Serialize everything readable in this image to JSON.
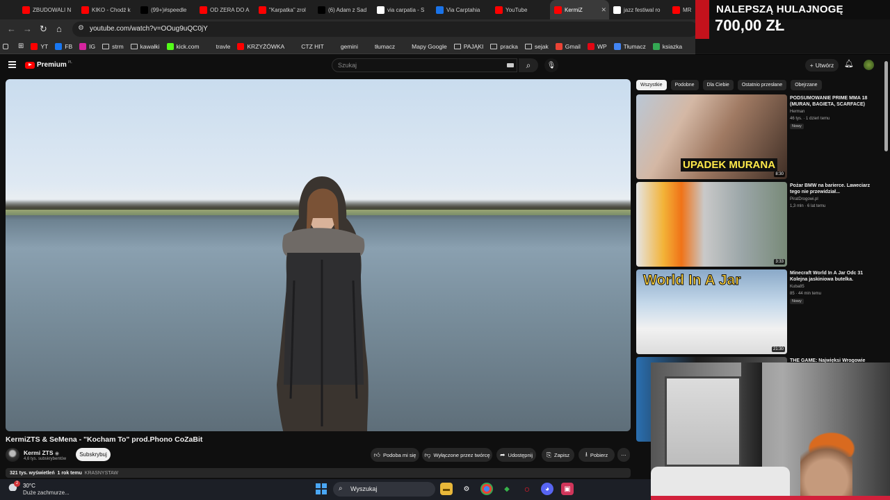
{
  "browser": {
    "tabs": [
      {
        "label": "ZBUDOWALI N",
        "icon": "youtube-icon",
        "color": "#ff0000"
      },
      {
        "label": "KIKO - Chodź k",
        "icon": "youtube-icon",
        "color": "#ff0000"
      },
      {
        "label": "(99+)#speedle",
        "icon": "tiktok-icon",
        "color": "#000000"
      },
      {
        "label": "OD ZERA DO A",
        "icon": "youtube-icon",
        "color": "#ff0000"
      },
      {
        "label": "\"Karpatka\" zrol",
        "icon": "youtube-icon",
        "color": "#ff0000"
      },
      {
        "label": "(6) Adam z Sad",
        "icon": "x-icon",
        "color": "#000000"
      },
      {
        "label": "via carpatia - S",
        "icon": "google-icon",
        "color": "#ffffff"
      },
      {
        "label": "Via Carptahia",
        "icon": "map-icon",
        "color": "#1a73e8"
      },
      {
        "label": "YouTube",
        "icon": "youtube-icon",
        "color": "#ff0000"
      },
      {
        "label": "KermiZ",
        "icon": "youtube-icon",
        "color": "#ff0000",
        "active": true
      },
      {
        "label": "jazz festiwal ro",
        "icon": "google-icon",
        "color": "#ffffff"
      },
      {
        "label": "MR",
        "icon": "youtube-icon",
        "color": "#ff0000"
      }
    ],
    "close_glyph": "✕",
    "url": "youtube.com/watch?v=OOug9uQC0jY",
    "bookmarks": [
      {
        "label": "YT",
        "icon": "youtube-icon",
        "color": "#ff0000"
      },
      {
        "label": "FB",
        "icon": "facebook-icon",
        "color": "#1877f2"
      },
      {
        "label": "IG",
        "icon": "instagram-icon",
        "color": "#d6249f"
      },
      {
        "label": "strm",
        "icon": "folder-icon",
        "color": "transparent"
      },
      {
        "label": "kawałki",
        "icon": "folder-icon",
        "color": "transparent"
      },
      {
        "label": "kick.com",
        "icon": "kick-icon",
        "color": "#53fc18"
      },
      {
        "label": "travle",
        "icon": "compass-icon",
        "color": "transparent"
      },
      {
        "label": "KRZYŻÓWKA",
        "icon": "youtube-icon",
        "color": "#ff0000"
      },
      {
        "label": "CTZ HIT",
        "icon": "gamepad-icon",
        "color": "transparent"
      },
      {
        "label": "gemini",
        "icon": "gemini-icon",
        "color": "transparent"
      },
      {
        "label": "tłumacz",
        "icon": "translate-icon",
        "color": "transparent"
      },
      {
        "label": "Mapy Google",
        "icon": "maps-pin-icon",
        "color": "transparent"
      },
      {
        "label": "PAJĄKI",
        "icon": "folder-icon",
        "color": "transparent"
      },
      {
        "label": "pracka",
        "icon": "folder-icon",
        "color": "transparent"
      },
      {
        "label": "sejak",
        "icon": "folder-icon",
        "color": "transparent"
      },
      {
        "label": "Gmail",
        "icon": "gmail-icon",
        "color": "#ea4335"
      },
      {
        "label": "WP",
        "icon": "wp-icon",
        "color": "#e30613"
      },
      {
        "label": "Tłumacz",
        "icon": "translate-icon",
        "color": "#4285f4"
      },
      {
        "label": "ksiazka",
        "icon": "apps-icon",
        "color": "#34a853"
      }
    ]
  },
  "overlay": {
    "promo_line1": "NALEPSZĄ HULAJNOGĘ",
    "promo_line2": "700,00 ZŁ"
  },
  "youtube": {
    "logo_text": "Premium",
    "logo_region": "PL",
    "search_placeholder": "Szukaj",
    "create_label": "Utwórz",
    "video": {
      "title": "KermiZTS & SeMena - \"Kocham To\" prod.Phono CoZaBit",
      "channel": "Kermi ZTS",
      "subscribers": "4,6 tys. subskrybentów",
      "subscribe_label": "Subskrybuj",
      "actions": {
        "like": "Podoba mi się",
        "creator": "Wyłączone przez twórcę",
        "share": "Udostępnij",
        "save": "Zapisz",
        "download": "Pobierz"
      },
      "views": "321 tys. wyświetleń",
      "age": "1 rok temu",
      "location": "KRASNYSTAW"
    },
    "chips": [
      "Wszystkie",
      "Podobne",
      "Dla Ciebie",
      "Ostatnio przesłane",
      "Obejrzane"
    ],
    "recommendations": [
      {
        "title": "PODSUMOWANIE PRIME MMA 18 (MURAN, BAGIETA, SCARFACE)",
        "channel": "Herman",
        "meta": "46 tys. · 1 dzień temu",
        "badge": "Nowy",
        "duration": "8:30",
        "thumb_text": "UPADEK MURANA"
      },
      {
        "title": "Pożar BMW na barierce. Laweciarz tego nie przewidział...",
        "channel": "PiratDrogowi.pl",
        "meta": "1,3 mln · 6 lat temu",
        "badge": "",
        "duration": "3:33",
        "thumb_text": ""
      },
      {
        "title": "Minecraft World In A Jar Odc 31 Kolejna jaskiniowa butelka.",
        "channel": "Kuba85",
        "meta": "85 · 44 min temu",
        "badge": "Nowy",
        "duration": "21:30",
        "thumb_text": "World In A Jar"
      },
      {
        "title": "THE GAME: Najwięksi Wrogowie",
        "channel": "",
        "meta": "",
        "badge": "",
        "duration": "",
        "thumb_text": ""
      }
    ]
  },
  "taskbar": {
    "temperature": "30°C",
    "weather": "Duże zachmurze...",
    "weather_badge": "2",
    "search_label": "Wyszukaj"
  }
}
